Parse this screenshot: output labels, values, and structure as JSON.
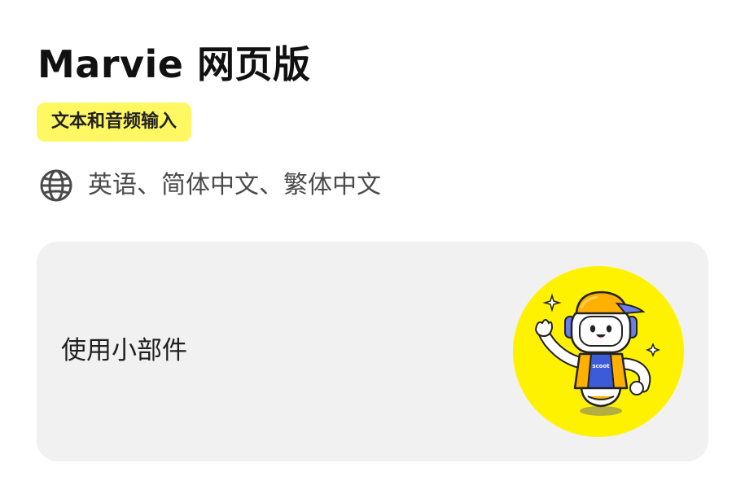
{
  "header": {
    "title": "Marvie 网页版"
  },
  "badge": {
    "label": "文本和音频输入"
  },
  "languages": {
    "icon": "globe-icon",
    "text": "英语、简体中文、繁体中文"
  },
  "widget_card": {
    "label": "使用小部件",
    "mascot_badge_text": "scoot",
    "mascot_icon": "robot-mascot-icon"
  },
  "colors": {
    "badge_background": "#fff862",
    "card_background": "#f1f1f1",
    "mascot_circle": "#fff200",
    "accent_blue": "#3c5bd9",
    "accent_orange": "#ffb000"
  }
}
